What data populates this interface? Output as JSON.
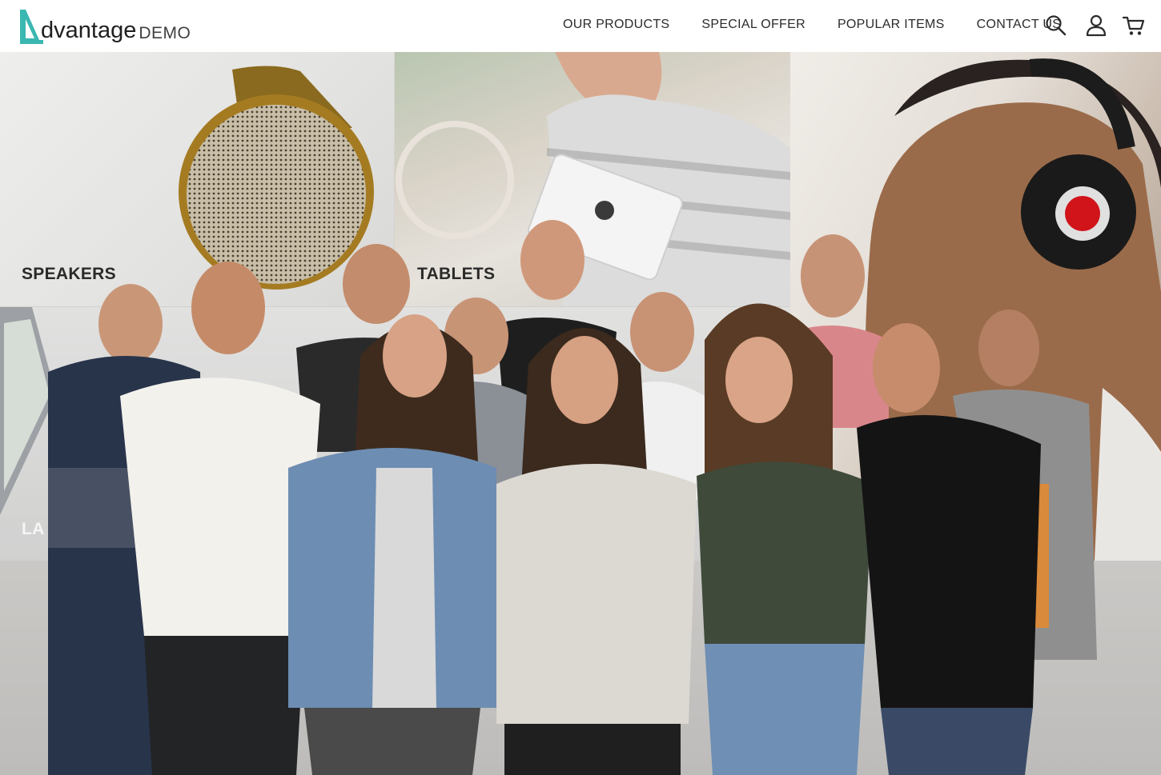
{
  "brand": {
    "name": "dvantage",
    "suffix": "DEMO",
    "accent_color": "#3ab7b0"
  },
  "nav": {
    "items": [
      {
        "label": "OUR PRODUCTS"
      },
      {
        "label": "SPECIAL OFFER"
      },
      {
        "label": "POPULAR ITEMS"
      },
      {
        "label": "CONTACT US"
      }
    ],
    "icons": [
      "search-icon",
      "user-icon",
      "cart-icon"
    ]
  },
  "categories": [
    {
      "label": "SPEAKERS"
    },
    {
      "label": "TABLETS"
    },
    {
      "label": "LA"
    }
  ]
}
